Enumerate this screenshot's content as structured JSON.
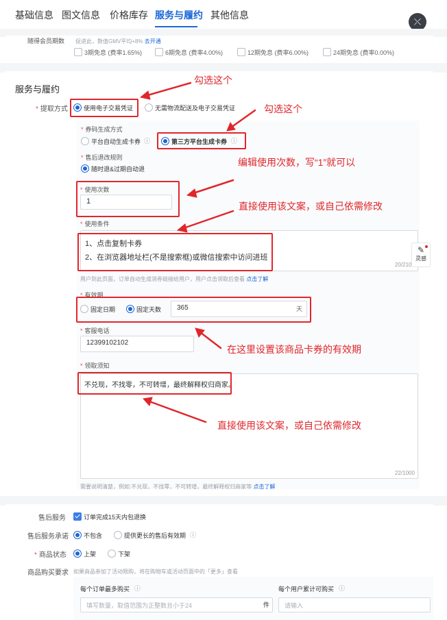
{
  "tabs": [
    {
      "label": "基础信息",
      "active": false
    },
    {
      "label": "图文信息",
      "active": false
    },
    {
      "label": "价格库存",
      "active": false
    },
    {
      "label": "服务与履约",
      "active": true
    },
    {
      "label": "其他信息",
      "active": false
    }
  ],
  "installment": {
    "label": "随得会员期数",
    "note": "促进此，数值GMV平均+8%",
    "note_link": "去开通",
    "options": [
      "3期免息 (费率1.65%)",
      "6期免息 (费率4.00%)",
      "12期免息 (费率6.00%)",
      "24期免息 (费率0.00%)"
    ]
  },
  "section": {
    "title": "服务与履约"
  },
  "pickup": {
    "label": "提取方式",
    "options": [
      "使用电子交易凭证",
      "无需物流配送及电子交易凭证"
    ],
    "selected": 0
  },
  "code_gen": {
    "label": "券码生成方式",
    "options": [
      "平台自动生成卡券",
      "第三方平台生成卡券"
    ],
    "selected": 1
  },
  "refund": {
    "label": "售后退改规则",
    "option": "随时退&过期自动退"
  },
  "usage_count": {
    "label": "使用次数",
    "value": "1"
  },
  "usage_cond": {
    "label": "使用条件",
    "lines": [
      "1、点击复制卡券",
      "2、在浏览器地址栏(不是搜索框)或微信搜索中访问进班"
    ],
    "counter": "20/210",
    "note": "用户到此页面，订单自动生成领券链接给用户，用户点击领取后查看",
    "note_link": "点击了解"
  },
  "validity": {
    "label": "有效期",
    "options": [
      "固定日期",
      "固定天数"
    ],
    "selected": 1,
    "value": "365",
    "unit": "天"
  },
  "phone": {
    "label": "客服电话",
    "value": "12399102102"
  },
  "notice": {
    "label": "领取须知",
    "value": "不兑现，不找零，不可转增，最终解释权归商家。",
    "counter": "22/1000",
    "note": "需要说明清楚，例如:不兑现，不找零，不可转增，最终解释权归商家等",
    "note_link": "点击了解"
  },
  "side_button": {
    "label": "灵感"
  },
  "guarantee": {
    "label": "售后服务",
    "option": "订单完成15天内包退换"
  },
  "after_sale": {
    "label": "售后服务承诺",
    "options": [
      "不包含",
      "提供更长的售后有效期"
    ],
    "selected": 0
  },
  "status": {
    "label": "商品状态",
    "options": [
      "上架",
      "下架"
    ],
    "selected": 0
  },
  "purchase": {
    "label": "商品购买要求",
    "note": "如果商品参加了活动限购，将在购物车或活动页面中的「更多」查看",
    "per_order_label": "每个订单最多购买",
    "per_order_placeholder": "填写数量，取值范围为正整数且小于24",
    "per_order_unit": "件",
    "per_user_label": "每个用户累计可购买",
    "per_user_placeholder": "请输入"
  },
  "annotations": {
    "a1": "勾选这个",
    "a2": "勾选这个",
    "a3": "编辑使用次数，写“1”就可以",
    "a4": "直接使用该文案，或自己依需修改",
    "a5": "在这里设置该商品卡券的有效期",
    "a6": "直接使用该文案，或自己依需修改"
  },
  "colors": {
    "accent": "#1b66d6",
    "annotation": "#e0262b"
  }
}
